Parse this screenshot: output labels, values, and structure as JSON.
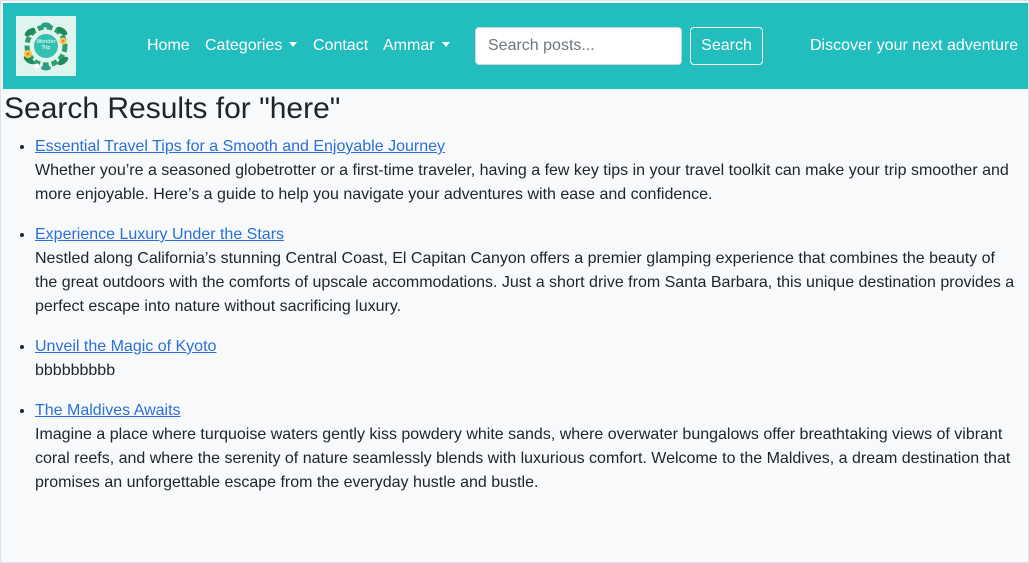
{
  "navbar": {
    "logo_text": "Wonder Trip",
    "links": [
      {
        "label": "Home"
      },
      {
        "label": "Categories"
      },
      {
        "label": "Contact"
      },
      {
        "label": "Ammar"
      }
    ],
    "search": {
      "placeholder": "Search posts...",
      "value": "",
      "button_label": "Search"
    },
    "tagline": "Discover your next adventure"
  },
  "main": {
    "title": "Search Results for \"here\"",
    "results": [
      {
        "title": "Essential Travel Tips for a Smooth and Enjoyable Journey",
        "excerpt": "Whether you’re a seasoned globetrotter or a first-time traveler, having a few key tips in your travel toolkit can make your trip smoother and more enjoyable. Here’s a guide to help you navigate your adventures with ease and confidence."
      },
      {
        "title": "Experience Luxury Under the Stars",
        "excerpt": "Nestled along California’s stunning Central Coast, El Capitan Canyon offers a premier glamping experience that combines the beauty of the great outdoors with the comforts of upscale accommodations. Just a short drive from Santa Barbara, this unique destination provides a perfect escape into nature without sacrificing luxury."
      },
      {
        "title": "Unveil the Magic of Kyoto",
        "excerpt": "bbbbbbbbb"
      },
      {
        "title": "The Maldives Awaits",
        "excerpt": "Imagine a place where turquoise waters gently kiss powdery white sands, where overwater bungalows offer breathtaking views of vibrant coral reefs, and where the serenity of nature seamlessly blends with luxurious comfort. Welcome to the Maldives, a dream destination that promises an unforgettable escape from the everyday hustle and bustle."
      }
    ]
  },
  "colors": {
    "navbar": "#22bdbd",
    "link": "#2a70d8",
    "text": "#212529",
    "background": "#f8f9fa"
  }
}
